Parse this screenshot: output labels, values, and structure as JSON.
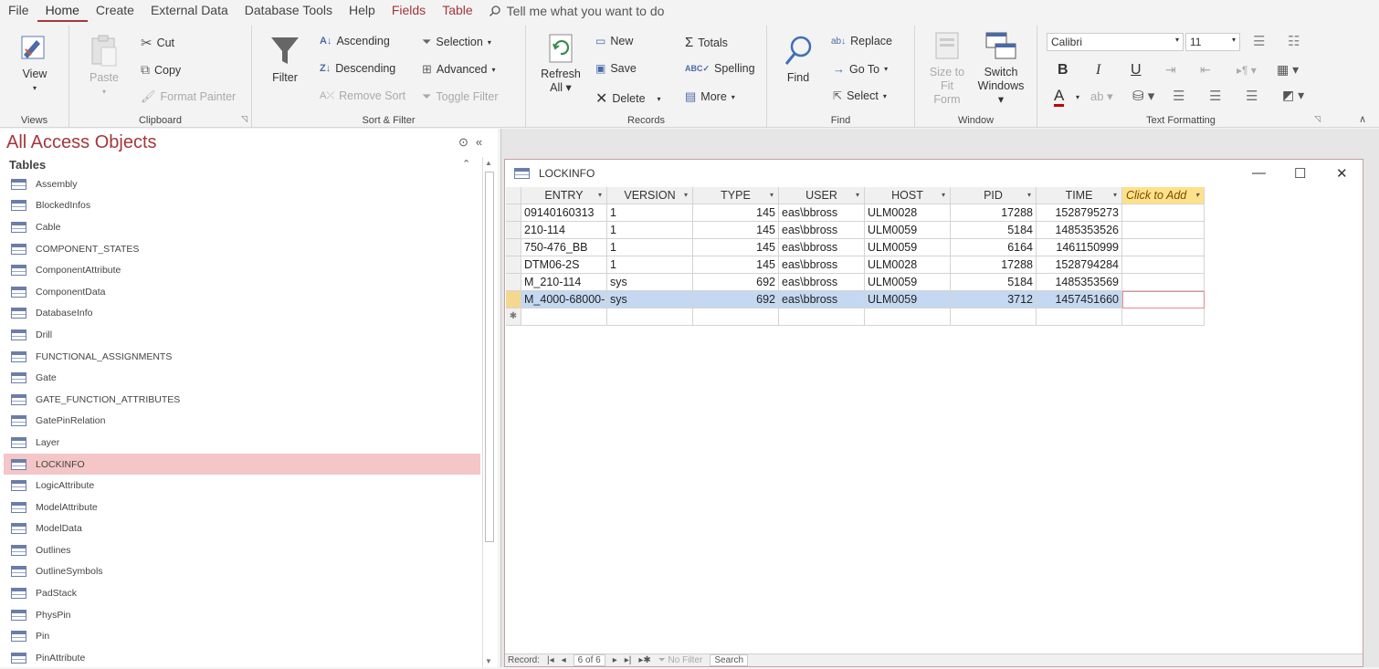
{
  "menu": {
    "items": [
      "File",
      "Home",
      "Create",
      "External Data",
      "Database Tools",
      "Help"
    ],
    "context": [
      "Fields",
      "Table"
    ],
    "tell_me": "Tell me what you want to do"
  },
  "ribbon": {
    "views": {
      "label": "Views",
      "view": "View"
    },
    "clipboard": {
      "label": "Clipboard",
      "paste": "Paste",
      "cut": "Cut",
      "copy": "Copy",
      "format_painter": "Format Painter"
    },
    "sort_filter": {
      "label": "Sort & Filter",
      "filter": "Filter",
      "ascending": "Ascending",
      "descending": "Descending",
      "remove_sort": "Remove Sort",
      "selection": "Selection",
      "advanced": "Advanced",
      "toggle_filter": "Toggle Filter"
    },
    "records": {
      "label": "Records",
      "refresh": "Refresh",
      "refresh_all": "All",
      "new": "New",
      "save": "Save",
      "delete": "Delete",
      "totals": "Totals",
      "spelling": "Spelling",
      "more": "More"
    },
    "find": {
      "label": "Find",
      "find": "Find",
      "replace": "Replace",
      "goto": "Go To",
      "select": "Select"
    },
    "window": {
      "label": "Window",
      "size_to": "Size to",
      "fit_form": "Fit Form",
      "switch": "Switch",
      "windows": "Windows"
    },
    "text_formatting": {
      "label": "Text Formatting",
      "font": "Calibri",
      "size": "11",
      "bold": "B",
      "italic": "I",
      "underline": "U",
      "font_color": "A"
    }
  },
  "nav": {
    "title": "All Access Objects",
    "section": "Tables",
    "items": [
      "Assembly",
      "BlockedInfos",
      "Cable",
      "COMPONENT_STATES",
      "ComponentAttribute",
      "ComponentData",
      "DatabaseInfo",
      "Drill",
      "FUNCTIONAL_ASSIGNMENTS",
      "Gate",
      "GATE_FUNCTION_ATTRIBUTES",
      "GatePinRelation",
      "Layer",
      "LOCKINFO",
      "LogicAttribute",
      "ModelAttribute",
      "ModelData",
      "Outlines",
      "OutlineSymbols",
      "PadStack",
      "PhysPin",
      "Pin",
      "PinAttribute"
    ],
    "selected_index": 13
  },
  "doc": {
    "title": "LOCKINFO",
    "columns": [
      "ENTRY",
      "VERSION",
      "TYPE",
      "USER",
      "HOST",
      "PID",
      "TIME"
    ],
    "add_column": "Click to Add",
    "rows": [
      [
        "09140160313",
        "1",
        "145",
        "eas\\bbross",
        "ULM0028",
        "17288",
        "1528795273"
      ],
      [
        "210-114",
        "1",
        "145",
        "eas\\bbross",
        "ULM0059",
        "5184",
        "1485353526"
      ],
      [
        "750-476_BB",
        "1",
        "145",
        "eas\\bbross",
        "ULM0059",
        "6164",
        "1461150999"
      ],
      [
        "DTM06-2S",
        "1",
        "145",
        "eas\\bbross",
        "ULM0028",
        "17288",
        "1528794284"
      ],
      [
        "M_210-114",
        "sys",
        "692",
        "eas\\bbross",
        "ULM0059",
        "5184",
        "1485353569"
      ],
      [
        "M_4000-68000-",
        "sys",
        "692",
        "eas\\bbross",
        "ULM0059",
        "3712",
        "1457451660"
      ]
    ],
    "current_row": 5,
    "new_row_marker": "✱",
    "record_nav": {
      "label": "Record:",
      "position": "6 of 6",
      "filter": "No Filter",
      "search": "Search"
    }
  },
  "colors": {
    "accent": "#a4373a",
    "selected_nav": "#f4c6c7",
    "selected_row": "#c4d9f1",
    "add_column": "#fde28a"
  }
}
